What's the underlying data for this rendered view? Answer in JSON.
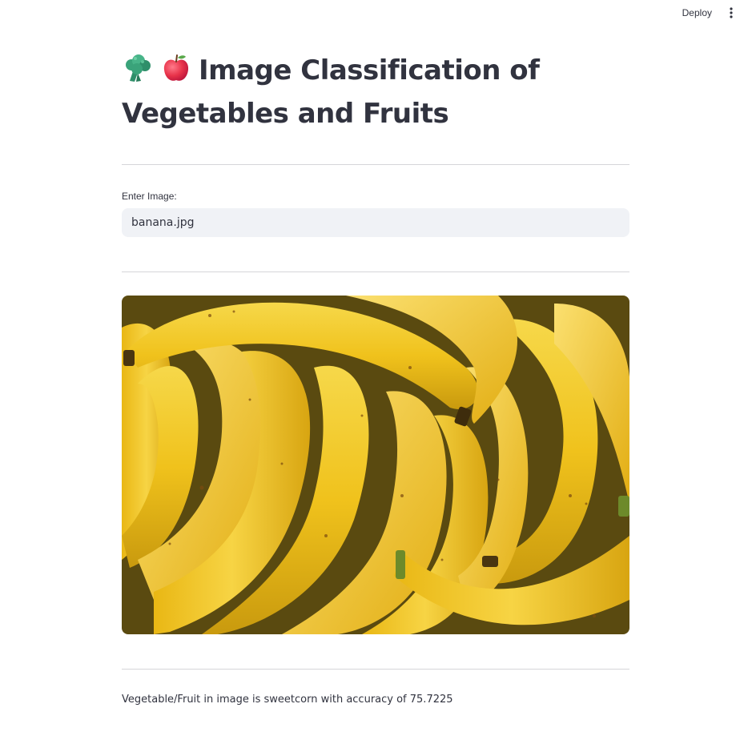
{
  "toolbar": {
    "deploy_label": "Deploy",
    "menu_icon": "vertical-ellipsis-icon"
  },
  "header": {
    "title": "Image Classification of Vegetables and Fruits",
    "emoji_icons": [
      "broccoli-icon",
      "apple-icon"
    ]
  },
  "form": {
    "input_label": "Enter Image:",
    "input_value": "banana.jpg"
  },
  "image": {
    "subject": "bananas",
    "icon": "banana-photo"
  },
  "result": {
    "text": "Vegetable/Fruit in image is sweetcorn with accuracy of 75.7225"
  },
  "colors": {
    "text": "#31333f",
    "input_bg": "#f0f2f6",
    "divider": "#d6d6d9",
    "banana_yellow": "#f2c21a",
    "apple_red": "#e8334a",
    "broccoli_green": "#3aa37a"
  }
}
